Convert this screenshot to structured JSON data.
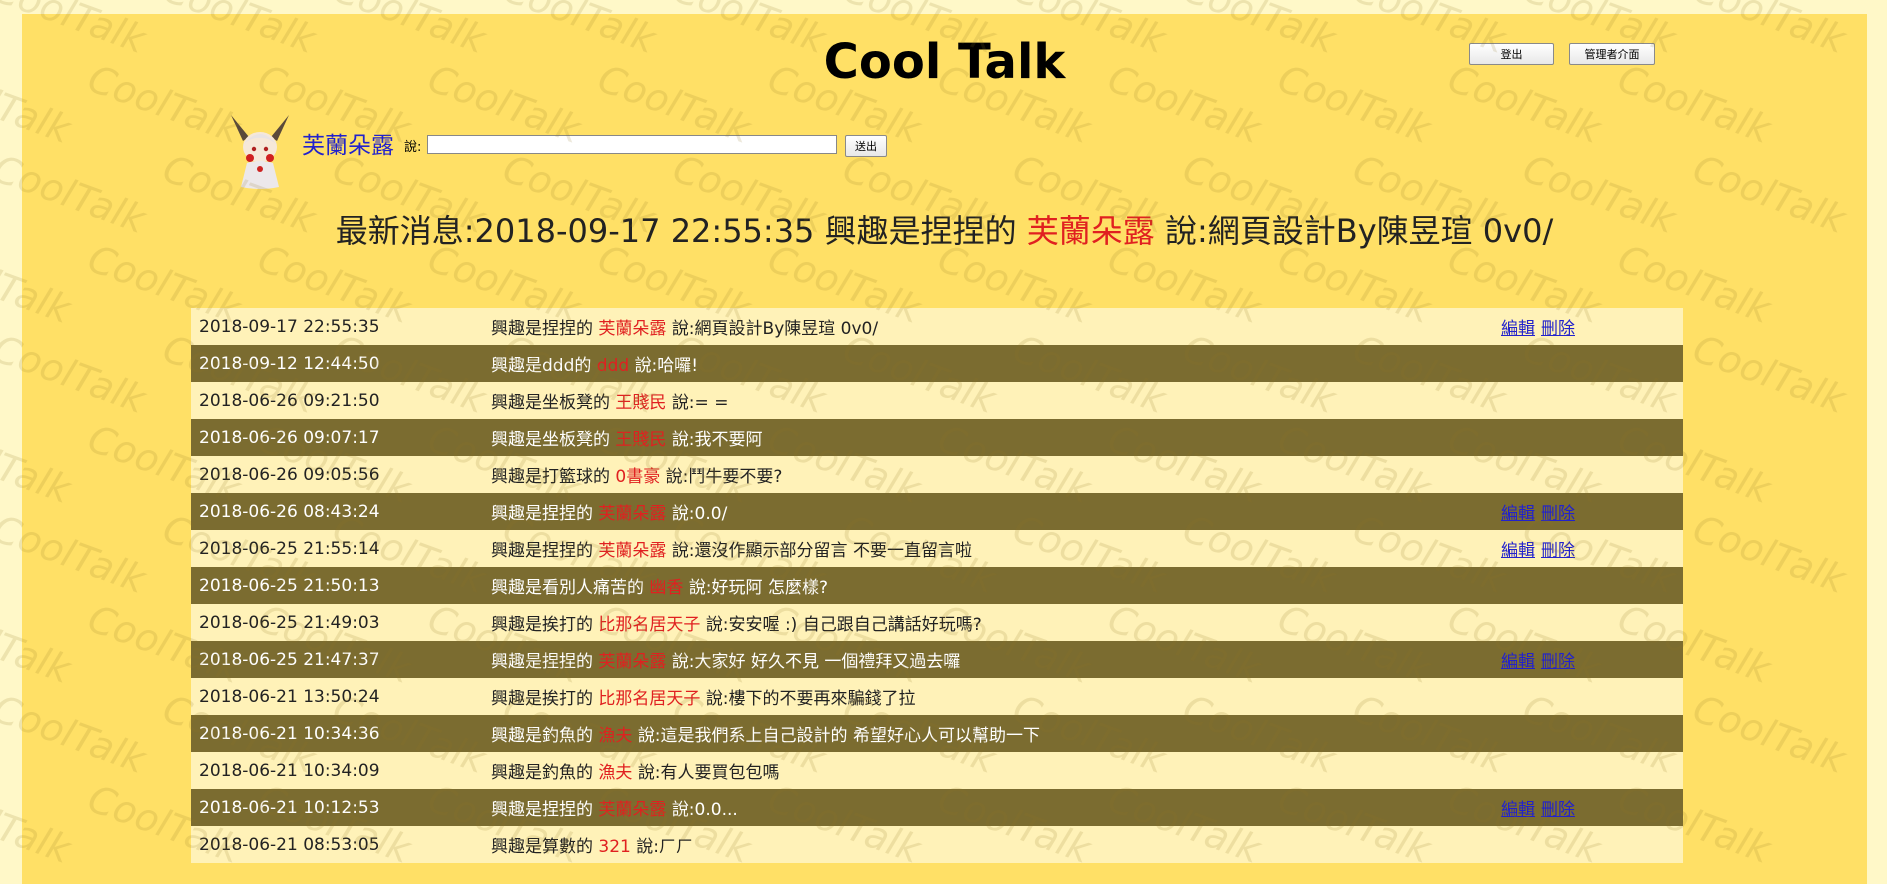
{
  "watermark": "CoolTalk",
  "colors": {
    "page_bg": "#fff8c8",
    "panel_bg": "#ffe066",
    "row_light": "#fff2b8",
    "row_dark": "#7b6c30",
    "name_red": "#e02020",
    "link_blue": "#2222cc"
  },
  "header": {
    "title": "Cool Talk",
    "logout_label": "登出",
    "admin_label": "管理者介面"
  },
  "compose": {
    "avatar_icon": "chibi-character-avatar",
    "user_name": "芙蘭朵露",
    "say_label": "說:",
    "input_value": "",
    "send_label": "送出"
  },
  "latest": {
    "prefix": "最新消息:",
    "time": "2018-09-17 22:55:35",
    "hobby": " 興趣是捏捏的 ",
    "name": "芙蘭朵露",
    "text": " 說:網頁設計By陳昱瑄 0v0/"
  },
  "action_labels": {
    "edit": "編輯",
    "delete": "刪除"
  },
  "messages": [
    {
      "time": "2018-09-17 22:55:35",
      "hobby": "興趣是捏捏的",
      "name": "芙蘭朵露",
      "text": "說:網頁設計By陳昱瑄 0v0/",
      "editable": true
    },
    {
      "time": "2018-09-12 12:44:50",
      "hobby": "興趣是ddd的",
      "name": "ddd",
      "text": "說:哈囉!",
      "editable": false
    },
    {
      "time": "2018-06-26 09:21:50",
      "hobby": "興趣是坐板凳的",
      "name": "王賤民",
      "text": "說:= =",
      "editable": false
    },
    {
      "time": "2018-06-26 09:07:17",
      "hobby": "興趣是坐板凳的",
      "name": "王賤民",
      "text": "說:我不要阿",
      "editable": false
    },
    {
      "time": "2018-06-26 09:05:56",
      "hobby": "興趣是打籃球的",
      "name": "0書豪",
      "text": "說:鬥牛要不要?",
      "editable": false
    },
    {
      "time": "2018-06-26 08:43:24",
      "hobby": "興趣是捏捏的",
      "name": "芙蘭朵露",
      "text": "說:0.0/",
      "editable": true
    },
    {
      "time": "2018-06-25 21:55:14",
      "hobby": "興趣是捏捏的",
      "name": "芙蘭朵露",
      "text": "說:還沒作顯示部分留言 不要一直留言啦",
      "editable": true
    },
    {
      "time": "2018-06-25 21:50:13",
      "hobby": "興趣是看別人痛苦的",
      "name": "幽香",
      "text": "說:好玩阿 怎麼樣?",
      "editable": false
    },
    {
      "time": "2018-06-25 21:49:03",
      "hobby": "興趣是挨打的",
      "name": "比那名居天子",
      "text": "說:安安喔 :) 自己跟自己講話好玩嗎?",
      "editable": false
    },
    {
      "time": "2018-06-25 21:47:37",
      "hobby": "興趣是捏捏的",
      "name": "芙蘭朵露",
      "text": "說:大家好 好久不見 一個禮拜又過去囉",
      "editable": true
    },
    {
      "time": "2018-06-21 13:50:24",
      "hobby": "興趣是挨打的",
      "name": "比那名居天子",
      "text": "說:樓下的不要再來騙錢了拉",
      "editable": false
    },
    {
      "time": "2018-06-21 10:34:36",
      "hobby": "興趣是釣魚的",
      "name": "漁夫",
      "text": "說:這是我們系上自己設計的 希望好心人可以幫助一下",
      "editable": false
    },
    {
      "time": "2018-06-21 10:34:09",
      "hobby": "興趣是釣魚的",
      "name": "漁夫",
      "text": "說:有人要買包包嗎",
      "editable": false
    },
    {
      "time": "2018-06-21 10:12:53",
      "hobby": "興趣是捏捏的",
      "name": "芙蘭朵露",
      "text": "說:0.0...",
      "editable": true
    },
    {
      "time": "2018-06-21 08:53:05",
      "hobby": "興趣是算數的",
      "name": "321",
      "text": "說:ㄏㄏ",
      "editable": false
    }
  ]
}
